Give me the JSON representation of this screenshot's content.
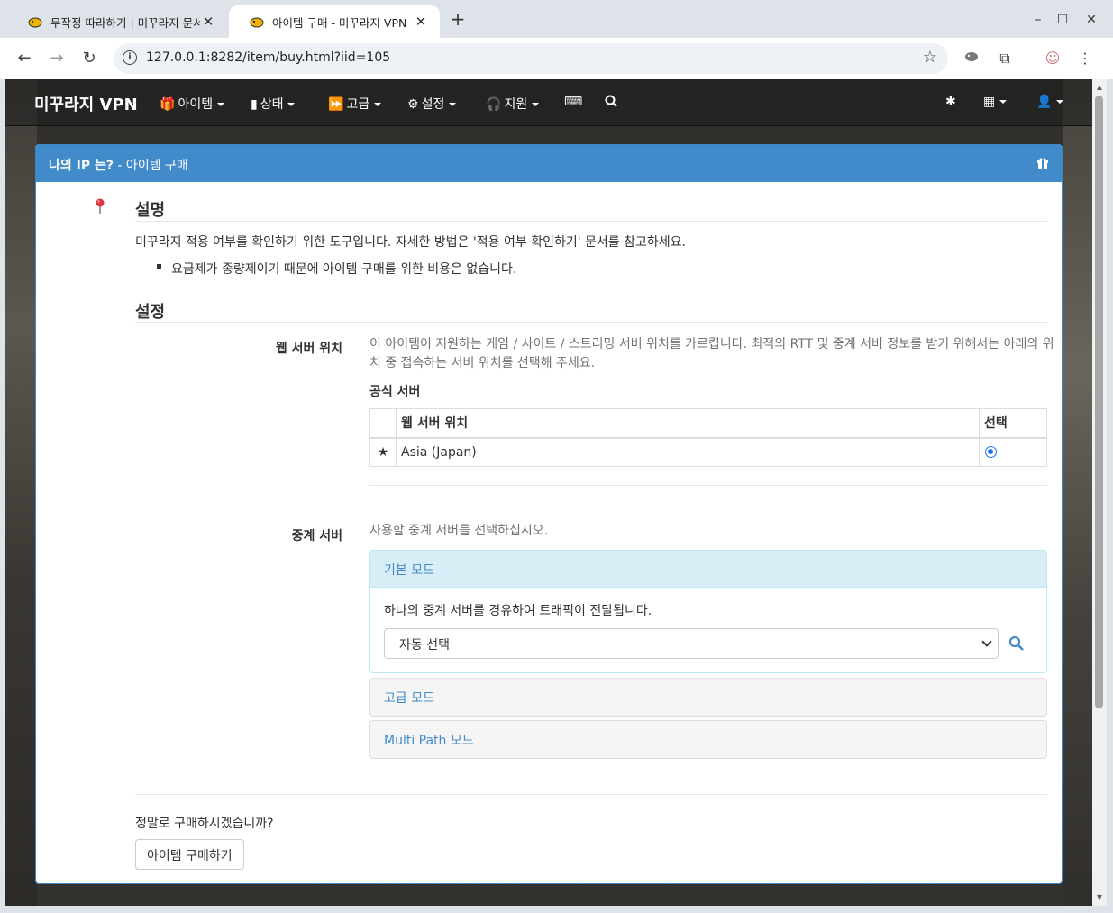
{
  "browser": {
    "tabs": [
      {
        "title": "무작정 따라하기 | 미꾸라지 문서",
        "active": false
      },
      {
        "title": "아이템 구매 - 미꾸라지 VPN",
        "active": true
      }
    ],
    "new_tab": "+",
    "url": "127.0.0.1:8282/item/buy.html?iid=105",
    "window_controls": {
      "minimize": "–",
      "maximize": "☐",
      "close": "✕"
    }
  },
  "navbar": {
    "brand": "미꾸라지 VPN",
    "items": [
      {
        "label": "아이템",
        "icon": "gift-icon"
      },
      {
        "label": "상태",
        "icon": "bar-chart-icon"
      },
      {
        "label": "고급",
        "icon": "fast-forward-icon"
      },
      {
        "label": "설정",
        "icon": "gear-icon"
      },
      {
        "label": "지원",
        "icon": "headphones-icon"
      }
    ]
  },
  "panel": {
    "title_bold": "나의 IP 는?",
    "title_rest": " - 아이템 구매"
  },
  "description": {
    "heading": "설명",
    "text": "미꾸라지 적용 여부를 확인하기 위한 도구입니다. 자세한 방법은 '적용 여부 확인하기' 문서를 참고하세요.",
    "bullet": "요금제가 종량제이기 때문에 아이템 구매를 위한 비용은 없습니다."
  },
  "settings": {
    "heading": "설정",
    "web_server": {
      "label": "웹 서버 위치",
      "help_line1": "이 아이템이 지원하는 게임 / 사이트 / 스트리밍 서버 위치를 가르킵니다. 최적의 RTT 및 중계 서버 정보를 받기 위해서는 아래의 위",
      "help_line2": "치 중 접속하는 서버 위치를 선택해 주세요.",
      "official_label": "공식 서버",
      "table": {
        "headers": [
          "",
          "웹 서버 위치",
          "선택"
        ],
        "rows": [
          {
            "mark": "★",
            "location": "Asia (Japan)",
            "selected": true
          }
        ]
      }
    },
    "relay": {
      "label": "중계 서버",
      "help": "사용할 중계 서버를 선택하십시오.",
      "modes": [
        {
          "title": "기본 모드",
          "open": true,
          "desc": "하나의 중계 서버를 경유하여 트래픽이 전달됩니다.",
          "select_value": "자동 선택"
        },
        {
          "title": "고급 모드",
          "open": false
        },
        {
          "title": "Multi Path 모드",
          "open": false
        }
      ]
    }
  },
  "confirm": {
    "question": "정말로 구매하시겠습니까?",
    "button": "아이템 구매하기"
  }
}
